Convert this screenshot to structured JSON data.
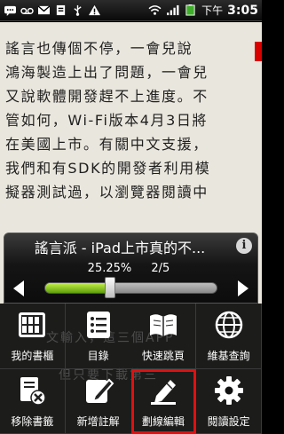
{
  "status_bar": {
    "ampm": "下午",
    "time": "3:05",
    "icons": [
      "sms-icon",
      "voicemail-icon",
      "gmail-icon",
      "clipboard-icon",
      "usb-icon",
      "warning-icon",
      "wifi-icon",
      "signal-icon",
      "battery-icon",
      "alarm-icon"
    ]
  },
  "page": {
    "lines": [
      "謠言也傳個不停，一會兒說",
      "鴻海製造上出了問題，一會兒",
      "又說軟體開發趕不上進度。不",
      "管如何，Wi-Fi版本4月3日將",
      "在美國上市。有關中文支援，",
      "我們和有SDK的開發者利用模",
      "擬器測試過，以瀏覽器閱讀中"
    ],
    "ghost_lines": [
      "文輸入，這三個APP",
      "但只要下載第三"
    ]
  },
  "panel": {
    "title": "謠言派 - iPad上市真的不...",
    "info_label": "i",
    "percent": "25.25%",
    "page_indicator": "2/5",
    "progress_fraction": 0.38
  },
  "menu": {
    "items": [
      {
        "label": "我的書櫃",
        "icon": "bookshelf-icon"
      },
      {
        "label": "目錄",
        "icon": "toc-icon"
      },
      {
        "label": "快速跳頁",
        "icon": "open-book-icon"
      },
      {
        "label": "維基查詢",
        "icon": "globe-icon"
      },
      {
        "label": "移除書籤",
        "icon": "remove-bookmark-icon"
      },
      {
        "label": "新增註解",
        "icon": "add-note-icon"
      },
      {
        "label": "劃線編輯",
        "icon": "highlight-pen-icon"
      },
      {
        "label": "閱讀設定",
        "icon": "gear-icon"
      }
    ]
  },
  "colors": {
    "page_bg": "#e9e6dd",
    "progress_green": "#7cc41f",
    "highlight_red": "#e01010"
  }
}
